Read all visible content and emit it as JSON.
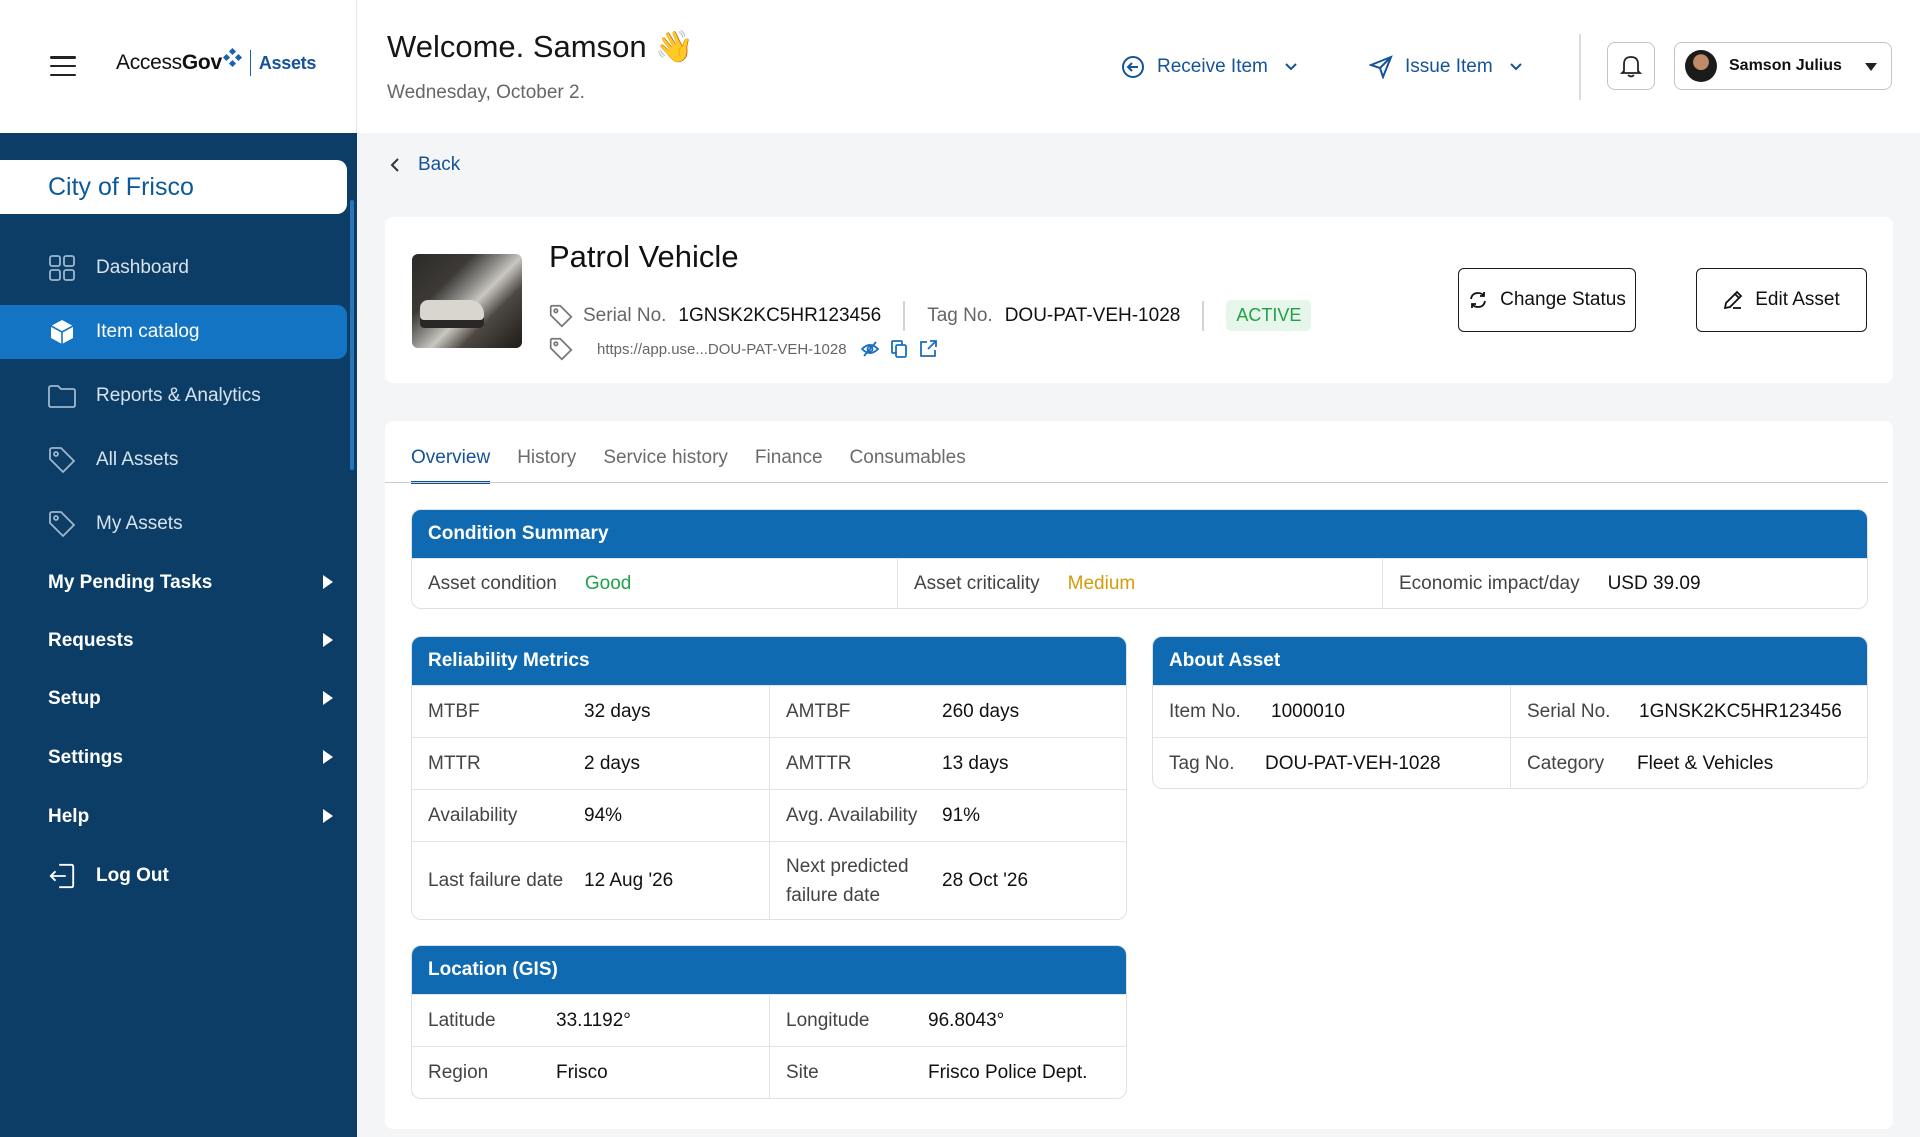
{
  "brand": {
    "name_prefix": "Access",
    "name_bold": "Gov",
    "product": "Assets"
  },
  "header": {
    "welcome": "Welcome. Samson 👋",
    "date": "Wednesday, October 2.",
    "receive_label": "Receive Item",
    "issue_label": "Issue Item",
    "user_name": "Samson Julius"
  },
  "sidebar": {
    "org": "City of Frisco",
    "items": [
      {
        "label": "Dashboard",
        "icon": "grid-icon"
      },
      {
        "label": "Item catalog",
        "icon": "box-icon",
        "active": true
      },
      {
        "label": "Reports & Analytics",
        "icon": "folder-icon"
      },
      {
        "label": "All Assets",
        "icon": "tag-icon"
      },
      {
        "label": "My Assets",
        "icon": "tag-icon"
      }
    ],
    "groups": [
      "My Pending Tasks",
      "Requests",
      "Setup",
      "Settings",
      "Help"
    ],
    "logout": "Log Out"
  },
  "back_label": "Back",
  "asset": {
    "title": "Patrol Vehicle",
    "serial_label": "Serial No.",
    "serial": "1GNSK2KC5HR123456",
    "tag_label": "Tag No.",
    "tag": "DOU-PAT-VEH-1028",
    "status": "ACTIVE",
    "url": "https://app.use...DOU-PAT-VEH-1028",
    "change_status": "Change Status",
    "edit_asset": "Edit Asset"
  },
  "tabs": [
    "Overview",
    "History",
    "Service history",
    "Finance",
    "Consumables"
  ],
  "condition": {
    "title": "Condition Summary",
    "asset_condition_label": "Asset condition",
    "asset_condition": "Good",
    "criticality_label": "Asset criticality",
    "criticality": "Medium",
    "impact_label": "Economic impact/day",
    "impact": "USD 39.09"
  },
  "reliability": {
    "title": "Reliability Metrics",
    "rows": [
      [
        "MTBF",
        "32 days",
        "AMTBF",
        "260 days"
      ],
      [
        "MTTR",
        "2 days",
        "AMTTR",
        "13 days"
      ],
      [
        "Availability",
        "94%",
        "Avg. Availability",
        "91%"
      ],
      [
        "Last failure date",
        "12 Aug '26",
        "Next predicted failure date",
        "28 Oct '26"
      ]
    ]
  },
  "about": {
    "title": "About Asset",
    "rows": [
      [
        "Item No.",
        "1000010",
        "Serial No.",
        "1GNSK2KC5HR123456"
      ],
      [
        "Tag No.",
        "DOU-PAT-VEH-1028",
        "Category",
        "Fleet & Vehicles"
      ]
    ]
  },
  "location": {
    "title": "Location (GIS)",
    "rows": [
      [
        "Latitude",
        "33.1192°",
        "Longitude",
        "96.8043°"
      ],
      [
        "Region",
        "Frisco",
        "Site",
        "Frisco Police Dept."
      ]
    ]
  },
  "colors": {
    "sidebar": "#0c3d66",
    "accent": "#14539a",
    "panel_header": "#0f6ab1",
    "good": "#22a04a",
    "medium": "#d29b0a"
  }
}
